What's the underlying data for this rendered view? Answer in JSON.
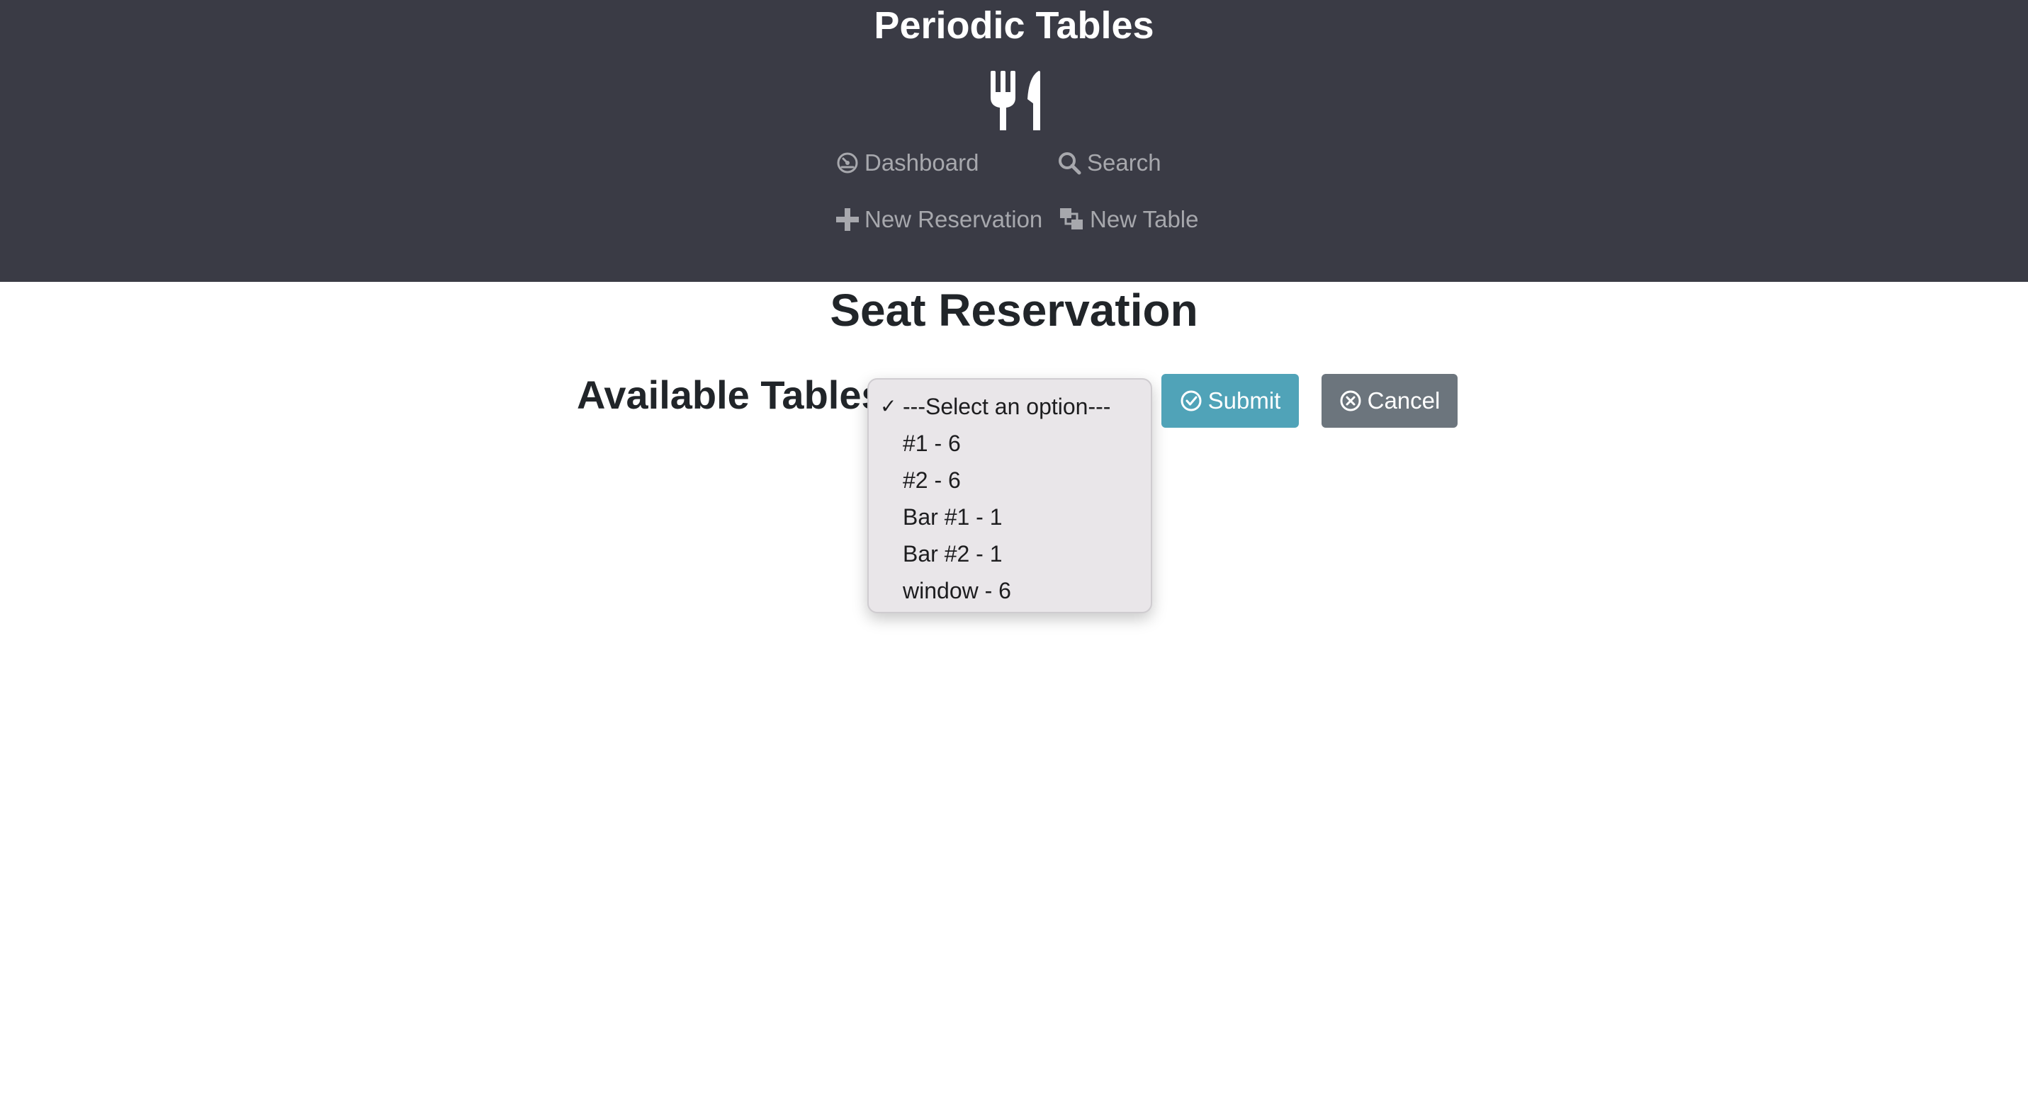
{
  "header": {
    "app_title": "Periodic Tables",
    "logo_icon": "utensils-icon",
    "nav": [
      {
        "label": "Dashboard",
        "icon": "dashboard-gauge-icon"
      },
      {
        "label": "Search",
        "icon": "search-icon"
      },
      {
        "label": "New Reservation",
        "icon": "plus-icon"
      },
      {
        "label": "New Table",
        "icon": "layers-icon"
      }
    ]
  },
  "main": {
    "page_title": "Seat Reservation",
    "table_select": {
      "label": "Available Tables:",
      "selected_index": 0,
      "options": [
        "---Select an option---",
        "#1 - 6",
        "#2 - 6",
        "Bar #1 - 1",
        "Bar #2 - 1",
        "window - 6"
      ]
    },
    "submit_label": "Submit",
    "cancel_label": "Cancel"
  },
  "colors": {
    "header_bg": "#3a3b45",
    "nav_text": "#a7a8ad",
    "submit_bg": "#50a3b8",
    "cancel_bg": "#6c757d"
  }
}
